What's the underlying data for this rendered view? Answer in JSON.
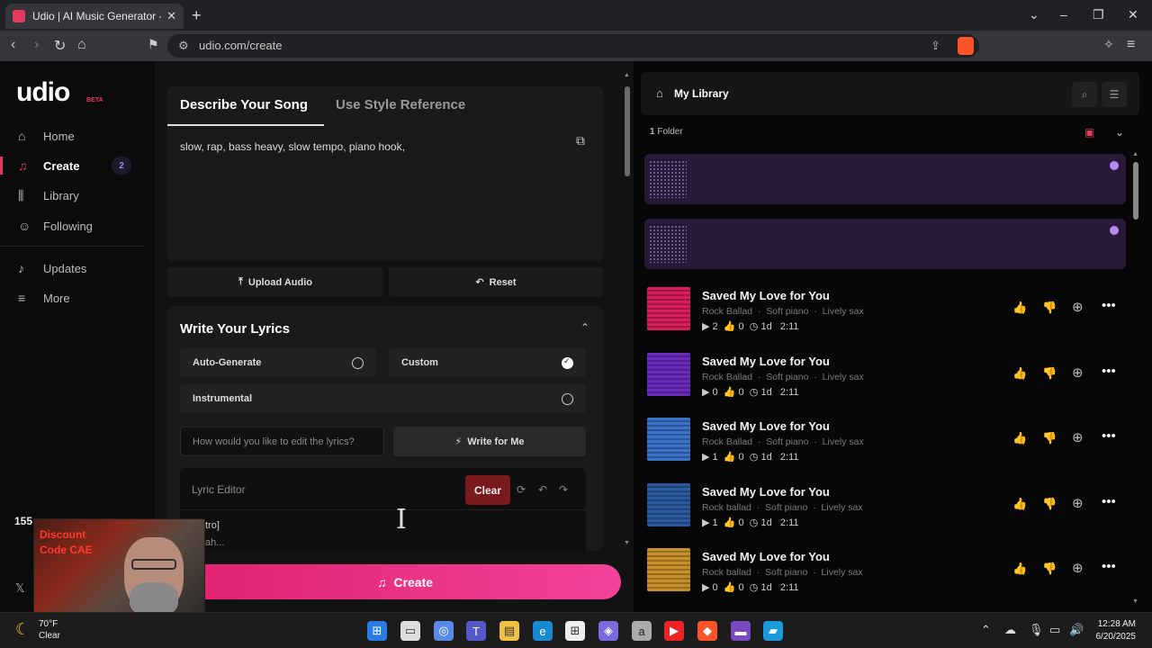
{
  "browser": {
    "tab_title": "Udio | AI Music Generator - Offic",
    "url": "udio.com/create"
  },
  "sidebar": {
    "logo": "udio",
    "beta": "BETA",
    "items": [
      {
        "label": "Home",
        "icon": "home-icon"
      },
      {
        "label": "Create",
        "icon": "music-note-icon",
        "badge": "2"
      },
      {
        "label": "Library",
        "icon": "library-icon"
      },
      {
        "label": "Following",
        "icon": "user-icon"
      },
      {
        "label": "Updates",
        "icon": "bell-icon"
      },
      {
        "label": "More",
        "icon": "menu-icon"
      }
    ],
    "credits": "155"
  },
  "create": {
    "tab_describe": "Describe Your Song",
    "tab_style": "Use Style Reference",
    "prompt": "slow, rap, bass heavy, slow tempo, piano hook,",
    "upload_label": "Upload Audio",
    "reset_label": "Reset",
    "lyrics_title": "Write Your Lyrics",
    "opt_auto": "Auto-Generate",
    "opt_custom": "Custom",
    "opt_instrumental": "Instrumental",
    "edit_placeholder": "How would you like to edit the lyrics?",
    "write_for_me": "Write for Me",
    "editor_label": "Lyric Editor",
    "clear_label": "Clear",
    "lyric_line1": "tro]",
    "lyric_line2": "ah...",
    "create_label": "Create"
  },
  "webcam": {
    "line1": "Discount",
    "line2": "Code CAE"
  },
  "library": {
    "title": "My Library",
    "folder_count": "1",
    "folder_label": "Folder",
    "songs": [
      {
        "title": "Saved My Love for You",
        "genre": "Rock Ballad",
        "tag2": "Soft piano",
        "tag3": "Lively sax",
        "plays": "2",
        "likes": "0",
        "age": "1d",
        "duration": "2:11",
        "art_color": "#d81e5b"
      },
      {
        "title": "Saved My Love for You",
        "genre": "Rock Ballad",
        "tag2": "Soft piano",
        "tag3": "Lively sax",
        "plays": "0",
        "likes": "0",
        "age": "1d",
        "duration": "2:11",
        "art_color": "#6a2ac0"
      },
      {
        "title": "Saved My Love for You",
        "genre": "Rock Ballad",
        "tag2": "Soft piano",
        "tag3": "Lively sax",
        "plays": "1",
        "likes": "0",
        "age": "1d",
        "duration": "2:11",
        "art_color": "#3a72c8"
      },
      {
        "title": "Saved My Love for You",
        "genre": "Rock ballad",
        "tag2": "Soft piano",
        "tag3": "Lively sax",
        "plays": "1",
        "likes": "0",
        "age": "1d",
        "duration": "2:11",
        "art_color": "#2a5aa0"
      },
      {
        "title": "Saved My Love for You",
        "genre": "Rock ballad",
        "tag2": "Soft piano",
        "tag3": "Lively sax",
        "plays": "0",
        "likes": "0",
        "age": "1d",
        "duration": "2:11",
        "art_color": "#c8902a"
      }
    ]
  },
  "taskbar": {
    "temp": "70°F",
    "weather": "Clear",
    "time": "12:28 AM",
    "date": "6/20/2025"
  }
}
